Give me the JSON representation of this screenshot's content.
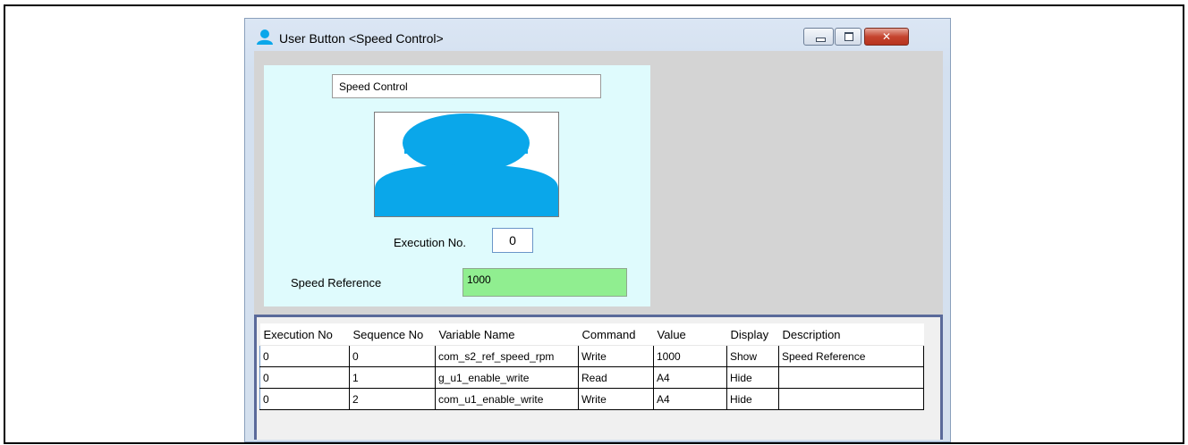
{
  "window": {
    "title": "User Button <Speed Control>",
    "icon": "user-icon",
    "controls": {
      "minimize_icon": "minimize-icon",
      "maximize_icon": "maximize-icon",
      "close_icon": "close-icon"
    }
  },
  "panel": {
    "button_name": "Speed Control",
    "image": "user-avatar-image",
    "execution_label": "Execution No.",
    "execution_value": "0",
    "speed_label": "Speed Reference",
    "speed_value": "1000",
    "colors": {
      "panel_bg": "#dffbfd",
      "speed_field_bg": "#90ee90",
      "avatar_blue": "#0aa7ea"
    }
  },
  "table": {
    "columns": [
      "Execution No",
      "Sequence No",
      "Variable Name",
      "Command",
      "Value",
      "Display",
      "Description"
    ],
    "rows": [
      [
        "0",
        "0",
        "com_s2_ref_speed_rpm",
        "Write",
        "1000",
        "Show",
        "Speed Reference"
      ],
      [
        "0",
        "1",
        "g_u1_enable_write",
        "Read",
        "A4",
        "Hide",
        ""
      ],
      [
        "0",
        "2",
        "com_u1_enable_write",
        "Write",
        "A4",
        "Hide",
        ""
      ]
    ]
  }
}
